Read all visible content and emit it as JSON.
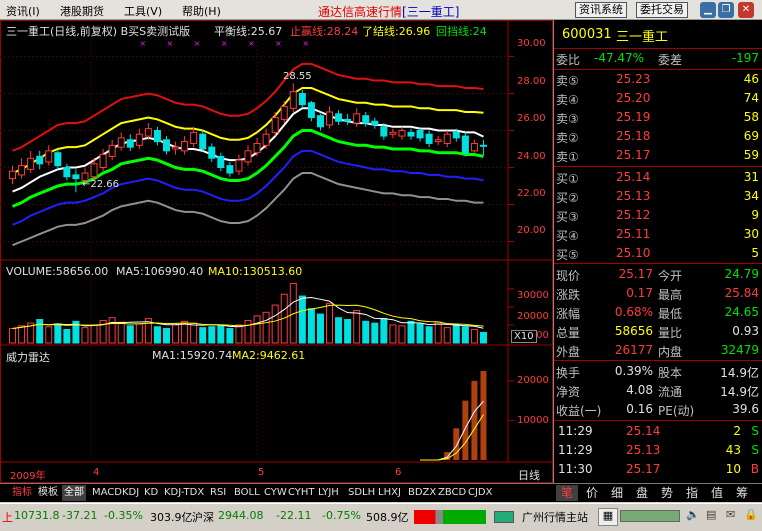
{
  "menu": {
    "items": [
      "资讯(I)",
      "港股期货",
      "工具(V)",
      "帮助(H)"
    ],
    "title": "通达信高速行情",
    "title_code": "[三一重工]",
    "buttons": [
      "资讯系统",
      "委托交易"
    ]
  },
  "chart": {
    "header": "三一重工(日线,前复权) B买S卖测试版",
    "balance_label": "平衡线:25.67",
    "upper_label": "止赢线:28.24",
    "close_label": "了结线:26.96",
    "back_label": "回挡线:24",
    "high_annotation": "28.55",
    "low_annotation": "←22.66",
    "price_ticks": [
      "30.00",
      "28.00",
      "26.00",
      "24.00",
      "22.00",
      "20.00"
    ],
    "volume_label": "VOLUME:58656.00",
    "ma5_label": "MA5:106990.40",
    "ma10_label": "MA10:130513.60",
    "volume_ticks": [
      "30000",
      "20000",
      "10000"
    ],
    "volume_unit": "X10",
    "radar_label": "威力雷达",
    "radar_ma1": "MA1:15920.74",
    "radar_ma2": "MA2:9462.61",
    "radar_ticks": [
      "20000",
      "10000"
    ],
    "year_label": "2009年",
    "month_labels": [
      "4",
      "5",
      "6"
    ],
    "period_label": "日线"
  },
  "chart_data": {
    "type": "candlestick",
    "title": "三一重工(日线,前复权)",
    "ylim": [
      19,
      31
    ],
    "days": 53,
    "open": [
      23.4,
      23.6,
      23.9,
      24.6,
      24.3,
      24.8,
      24.0,
      23.6,
      23.3,
      23.5,
      24.0,
      24.6,
      25.1,
      25.5,
      25.2,
      25.7,
      26.0,
      25.5,
      25.0,
      24.9,
      25.3,
      25.8,
      25.1,
      24.6,
      24.1,
      23.8,
      24.3,
      24.8,
      25.2,
      25.9,
      26.6,
      27.2,
      28.0,
      27.5,
      26.8,
      26.3,
      26.9,
      26.6,
      26.4,
      26.8,
      26.5,
      26.2,
      25.8,
      25.7,
      25.9,
      26.0,
      25.8,
      25.4,
      25.3,
      25.9,
      25.7,
      24.9,
      25.2
    ],
    "close": [
      23.8,
      24.1,
      24.5,
      24.2,
      24.9,
      24.1,
      23.5,
      23.4,
      23.7,
      24.2,
      24.7,
      25.2,
      25.6,
      25.1,
      25.8,
      26.1,
      25.4,
      24.9,
      25.1,
      25.4,
      25.9,
      25.0,
      24.5,
      24.0,
      23.7,
      24.4,
      24.9,
      25.3,
      25.8,
      26.7,
      27.3,
      28.1,
      27.4,
      26.7,
      26.2,
      27.0,
      26.5,
      26.5,
      26.9,
      26.4,
      26.3,
      25.7,
      25.9,
      26.0,
      25.7,
      25.6,
      25.3,
      25.5,
      25.8,
      25.6,
      24.8,
      25.3,
      25.17
    ],
    "high": [
      24.1,
      24.5,
      24.9,
      24.9,
      25.2,
      25.0,
      24.2,
      23.9,
      24.0,
      24.5,
      25.0,
      25.5,
      25.9,
      25.8,
      26.1,
      26.4,
      26.2,
      25.7,
      25.4,
      25.7,
      26.2,
      26.0,
      25.3,
      24.8,
      24.3,
      24.7,
      25.2,
      25.6,
      26.1,
      27.0,
      27.6,
      28.55,
      28.2,
      27.6,
      26.9,
      27.3,
      27.1,
      26.9,
      27.2,
      27.0,
      26.7,
      26.4,
      26.1,
      26.2,
      26.1,
      26.2,
      26.0,
      25.7,
      26.0,
      26.1,
      25.9,
      25.5,
      25.5
    ],
    "low": [
      23.1,
      23.4,
      23.7,
      23.9,
      24.1,
      23.9,
      23.3,
      22.66,
      23.1,
      23.3,
      23.8,
      24.4,
      24.9,
      24.9,
      25.0,
      25.5,
      25.2,
      24.7,
      24.7,
      24.7,
      25.1,
      24.9,
      24.3,
      23.8,
      23.5,
      23.6,
      24.1,
      24.6,
      25.0,
      25.7,
      26.4,
      27.0,
      27.2,
      26.5,
      26.0,
      26.1,
      26.3,
      26.3,
      26.2,
      26.2,
      26.1,
      25.5,
      25.6,
      25.5,
      25.5,
      25.4,
      25.1,
      25.2,
      25.1,
      25.4,
      24.6,
      24.8,
      24.65
    ],
    "lines": {
      "red": [
        24.9,
        25.1,
        25.4,
        25.7,
        26.0,
        26.3,
        26.4,
        26.4,
        26.5,
        26.8,
        27.1,
        27.4,
        27.7,
        27.8,
        27.9,
        28.0,
        27.9,
        27.7,
        27.5,
        27.4,
        27.4,
        27.3,
        27.1,
        26.9,
        26.8,
        26.8,
        26.9,
        27.2,
        27.6,
        28.1,
        28.7,
        29.3,
        29.6,
        29.6,
        29.4,
        29.2,
        29.0,
        28.9,
        28.8,
        28.8,
        28.7,
        28.7,
        28.6,
        28.6,
        28.6,
        28.5,
        28.5,
        28.4,
        28.4,
        28.4,
        28.3,
        28.3,
        28.24
      ],
      "yellow": [
        23.7,
        23.9,
        24.2,
        24.5,
        24.8,
        25.0,
        25.1,
        25.1,
        25.2,
        25.5,
        25.8,
        26.1,
        26.4,
        26.5,
        26.6,
        26.7,
        26.6,
        26.4,
        26.2,
        26.1,
        26.1,
        26.0,
        25.8,
        25.6,
        25.5,
        25.5,
        25.6,
        25.9,
        26.3,
        26.8,
        27.4,
        28.0,
        28.3,
        28.3,
        28.1,
        27.9,
        27.7,
        27.6,
        27.5,
        27.5,
        27.4,
        27.4,
        27.3,
        27.3,
        27.3,
        27.2,
        27.2,
        27.1,
        27.1,
        27.1,
        27.0,
        27.0,
        26.96
      ],
      "white": [
        22.7,
        22.9,
        23.2,
        23.5,
        23.7,
        23.9,
        24.0,
        24.0,
        24.1,
        24.4,
        24.7,
        25.0,
        25.3,
        25.4,
        25.5,
        25.6,
        25.5,
        25.3,
        25.1,
        25.0,
        25.0,
        24.9,
        24.7,
        24.5,
        24.4,
        24.4,
        24.5,
        24.8,
        25.2,
        25.7,
        26.3,
        26.9,
        27.2,
        27.2,
        27.0,
        26.8,
        26.6,
        26.5,
        26.4,
        26.4,
        26.3,
        26.3,
        26.2,
        26.2,
        26.2,
        26.1,
        26.1,
        26.0,
        26.0,
        26.0,
        25.9,
        25.9,
        25.67
      ],
      "green": [
        21.9,
        22.1,
        22.4,
        22.6,
        22.8,
        23.0,
        23.1,
        23.1,
        23.2,
        23.4,
        23.7,
        23.9,
        24.2,
        24.3,
        24.4,
        24.5,
        24.4,
        24.2,
        24.0,
        23.9,
        23.9,
        23.8,
        23.6,
        23.4,
        23.3,
        23.3,
        23.4,
        23.7,
        24.1,
        24.6,
        25.1,
        25.7,
        26.0,
        26.0,
        25.8,
        25.6,
        25.4,
        25.3,
        25.2,
        25.2,
        25.1,
        25.1,
        25.0,
        25.0,
        25.0,
        24.9,
        24.9,
        24.8,
        24.8,
        24.8,
        24.7,
        24.7,
        24.6
      ],
      "blue": [
        20.9,
        21.1,
        21.4,
        21.6,
        21.8,
        22.0,
        22.1,
        22.1,
        22.2,
        22.4,
        22.6,
        22.9,
        23.1,
        23.2,
        23.3,
        23.4,
        23.3,
        23.1,
        22.9,
        22.8,
        22.8,
        22.7,
        22.5,
        22.3,
        22.2,
        22.2,
        22.3,
        22.6,
        23.0,
        23.5,
        24.0,
        24.6,
        24.9,
        24.9,
        24.7,
        24.5,
        24.3,
        24.2,
        24.1,
        24.0,
        23.9,
        23.9,
        23.8,
        23.8,
        23.7,
        23.7,
        23.6,
        23.6,
        23.5,
        23.5,
        23.4,
        23.4,
        23.3
      ],
      "gray": [
        19.8,
        20.0,
        20.2,
        20.4,
        20.6,
        20.8,
        20.9,
        20.9,
        21.0,
        21.2,
        21.4,
        21.7,
        21.9,
        22.0,
        22.1,
        22.2,
        22.1,
        21.9,
        21.7,
        21.6,
        21.6,
        21.5,
        21.3,
        21.1,
        21.0,
        21.0,
        21.1,
        21.4,
        21.8,
        22.3,
        22.8,
        23.4,
        23.7,
        23.7,
        23.5,
        23.3,
        23.1,
        23.0,
        22.9,
        22.8,
        22.7,
        22.6,
        22.6,
        22.5,
        22.5,
        22.4,
        22.4,
        22.3,
        22.3,
        22.2,
        22.2,
        22.1,
        22.1
      ]
    },
    "volume": [
      8000,
      9500,
      11000,
      13000,
      9000,
      10500,
      7500,
      12000,
      8500,
      10000,
      12500,
      14000,
      11500,
      9500,
      10500,
      13500,
      9000,
      8000,
      10000,
      12000,
      11000,
      8500,
      9000,
      9500,
      8000,
      10000,
      12500,
      15000,
      17000,
      21000,
      27000,
      33000,
      26000,
      19000,
      16000,
      22000,
      14000,
      13000,
      18000,
      12000,
      11000,
      13500,
      10000,
      9500,
      12000,
      10500,
      9000,
      11500,
      8500,
      10000,
      9000,
      7500,
      5866
    ],
    "radar": [
      0,
      0,
      0,
      0,
      0,
      0,
      0,
      0,
      0,
      0,
      0,
      0,
      0,
      0,
      0,
      0,
      0,
      0,
      0,
      0,
      0,
      0,
      0,
      0,
      0,
      0,
      0,
      0,
      0,
      0,
      0,
      0,
      0,
      0,
      0,
      0,
      0,
      0,
      0,
      0,
      0,
      0,
      0,
      0,
      0,
      0,
      0,
      0,
      2000,
      8000,
      15000,
      20000,
      22500
    ]
  },
  "quote": {
    "code": "600031",
    "name": "三一重工",
    "weibi_label": "委比",
    "weibi_value": "-47.47%",
    "weicha_label": "委差",
    "weicha_value": "-197",
    "sells": [
      {
        "label": "卖⑤",
        "price": "25.23",
        "vol": "46"
      },
      {
        "label": "卖④",
        "price": "25.20",
        "vol": "74"
      },
      {
        "label": "卖③",
        "price": "25.19",
        "vol": "58"
      },
      {
        "label": "卖②",
        "price": "25.18",
        "vol": "69"
      },
      {
        "label": "卖①",
        "price": "25.17",
        "vol": "59"
      }
    ],
    "buys": [
      {
        "label": "买①",
        "price": "25.14",
        "vol": "31"
      },
      {
        "label": "买②",
        "price": "25.13",
        "vol": "34"
      },
      {
        "label": "买③",
        "price": "25.12",
        "vol": "9"
      },
      {
        "label": "买④",
        "price": "25.11",
        "vol": "30"
      },
      {
        "label": "买⑤",
        "price": "25.10",
        "vol": "5"
      }
    ],
    "stats": [
      {
        "l1": "现价",
        "v1": "25.17",
        "c1": "red",
        "l2": "今开",
        "v2": "24.79",
        "c2": "green"
      },
      {
        "l1": "涨跌",
        "v1": "0.17",
        "c1": "red",
        "l2": "最高",
        "v2": "25.84",
        "c2": "red"
      },
      {
        "l1": "涨幅",
        "v1": "0.68%",
        "c1": "red",
        "l2": "最低",
        "v2": "24.65",
        "c2": "green"
      },
      {
        "l1": "总量",
        "v1": "58656",
        "c1": "yellow",
        "l2": "量比",
        "v2": "0.93",
        "c2": "white"
      },
      {
        "l1": "外盘",
        "v1": "26177",
        "c1": "red",
        "l2": "内盘",
        "v2": "32479",
        "c2": "green"
      }
    ],
    "fin": [
      {
        "l1": "换手",
        "v1": "0.39%",
        "l2": "股本",
        "v2": "14.9亿"
      },
      {
        "l1": "净资",
        "v1": "4.08",
        "l2": "流通",
        "v2": "14.9亿"
      },
      {
        "l1": "收益(一)",
        "v1": "0.16",
        "l2": "PE(动)",
        "v2": "39.6"
      }
    ],
    "ticks": [
      {
        "time": "11:29",
        "price": "25.14",
        "pc": "red",
        "vol": "2",
        "side": "S",
        "sc": "green"
      },
      {
        "time": "11:29",
        "price": "25.13",
        "pc": "red",
        "vol": "43",
        "side": "S",
        "sc": "green"
      },
      {
        "time": "11:30",
        "price": "25.17",
        "pc": "red",
        "vol": "10",
        "side": "B",
        "sc": "red"
      }
    ]
  },
  "tabs": [
    "指标",
    "模板",
    "全部",
    "MACD",
    "KDJ",
    "KD",
    "KDJ-TDX",
    "RSI",
    "BOLL",
    "CYW",
    "CYHT",
    "LYJH",
    "SDLH",
    "LHXJ",
    "BDZX",
    "ZBCD",
    "CJDX"
  ],
  "right_tabs": [
    "笔",
    "价",
    "细",
    "盘",
    "势",
    "指",
    "值",
    "筹"
  ],
  "status": {
    "sh_index": "10731.8",
    "sh_change": "-37.21",
    "sh_pct": "-0.35%",
    "sh_amount": "303.9亿",
    "sz_name": "沪深",
    "sz_index": "2944.08",
    "sz_change": "-22.11",
    "sz_pct": "-0.75%",
    "sz_amount": "508.9亿",
    "server": "广州行情主站"
  },
  "colors": {
    "up": "#ff3c3c",
    "down": "#00e0e0",
    "background": "#000000"
  }
}
